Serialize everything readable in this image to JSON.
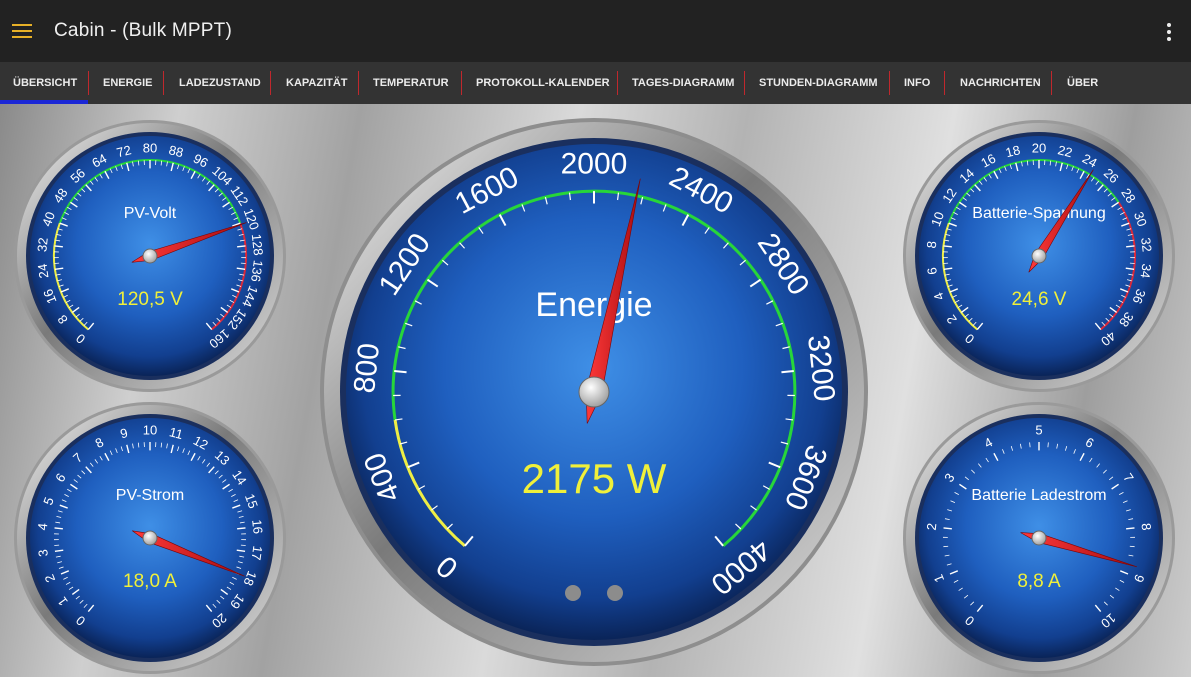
{
  "app_bar": {
    "title": "Cabin - (Bulk MPPT)",
    "menu_icon": "hamburger-menu-icon",
    "overflow_icon": "overflow-menu-icon"
  },
  "tabs": [
    {
      "label": "ÜBERSICHT",
      "active": true
    },
    {
      "label": "ENERGIE"
    },
    {
      "label": "LADEZUSTAND"
    },
    {
      "label": "KAPAZITÄT"
    },
    {
      "label": "TEMPERATUR"
    },
    {
      "label": "PROTOKOLL-KALENDER"
    },
    {
      "label": "TAGES-DIAGRAMM"
    },
    {
      "label": "STUNDEN-DIAGRAMM"
    },
    {
      "label": "INFO"
    },
    {
      "label": "NACHRICHTEN"
    },
    {
      "label": "ÜBER"
    }
  ],
  "colors": {
    "accent_menu": "#e7b027",
    "tab_indicator": "#1b27d6",
    "tab_separator": "#c0282d",
    "value_text": "#f0f03a",
    "dial_blue": "#1f5fbf",
    "needle": "#d4141e",
    "arc_green": "#27d63a",
    "arc_yellow": "#eeee44",
    "arc_red": "#d8283a"
  },
  "gauges": {
    "pv_volt": {
      "title": "PV-Volt",
      "value": 120.5,
      "display": "120,5 V",
      "ticks": [
        "0",
        "8",
        "16",
        "24",
        "32",
        "40",
        "48",
        "56",
        "64",
        "72",
        "80",
        "88",
        "96",
        "104",
        "112",
        "120",
        "128",
        "136",
        "144",
        "152",
        "160"
      ],
      "min": 0,
      "max": 160
    },
    "pv_strom": {
      "title": "PV-Strom",
      "value": 18.0,
      "display": "18,0 A",
      "ticks": [
        "0",
        "1",
        "2",
        "3",
        "4",
        "5",
        "6",
        "7",
        "8",
        "9",
        "10",
        "11",
        "12",
        "13",
        "14",
        "15",
        "16",
        "17",
        "18",
        "19",
        "20"
      ],
      "min": 0,
      "max": 20
    },
    "energie": {
      "title": "Energie",
      "value": 2175,
      "display": "2175 W",
      "ticks": [
        "0",
        "400",
        "800",
        "1200",
        "1600",
        "2000",
        "2400",
        "2800",
        "3200",
        "3600",
        "4000"
      ],
      "min": 0,
      "max": 4000
    },
    "batt_spannung": {
      "title": "Batterie-Spannung",
      "value": 24.6,
      "display": "24,6 V",
      "ticks": [
        "0",
        "2",
        "4",
        "6",
        "8",
        "10",
        "12",
        "14",
        "16",
        "18",
        "20",
        "22",
        "24",
        "26",
        "28",
        "30",
        "32",
        "34",
        "36",
        "38",
        "40"
      ],
      "min": 0,
      "max": 40
    },
    "batt_ladestrom": {
      "title": "Batterie Ladestrom",
      "value": 8.8,
      "display": "8,8 A",
      "ticks": [
        "0",
        "1",
        "2",
        "3",
        "4",
        "5",
        "6",
        "7",
        "8",
        "9",
        "10"
      ],
      "min": 0,
      "max": 10
    }
  }
}
